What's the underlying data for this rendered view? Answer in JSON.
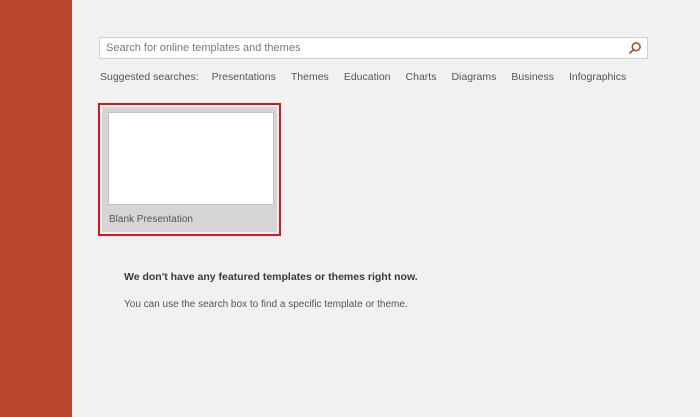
{
  "search": {
    "placeholder": "Search for online templates and themes",
    "value": ""
  },
  "suggested": {
    "label": "Suggested searches:",
    "links": [
      "Presentations",
      "Themes",
      "Education",
      "Charts",
      "Diagrams",
      "Business",
      "Infographics"
    ]
  },
  "templates": [
    {
      "label": "Blank Presentation"
    }
  ],
  "message": {
    "title": "We don't have any featured templates or themes right now.",
    "body": "You can use the search box to find a specific template or theme."
  },
  "colors": {
    "sidebar": "#b9462a",
    "highlight": "#d9161e",
    "search_icon": "#b9462a"
  },
  "icons": {
    "search": "search-icon"
  }
}
